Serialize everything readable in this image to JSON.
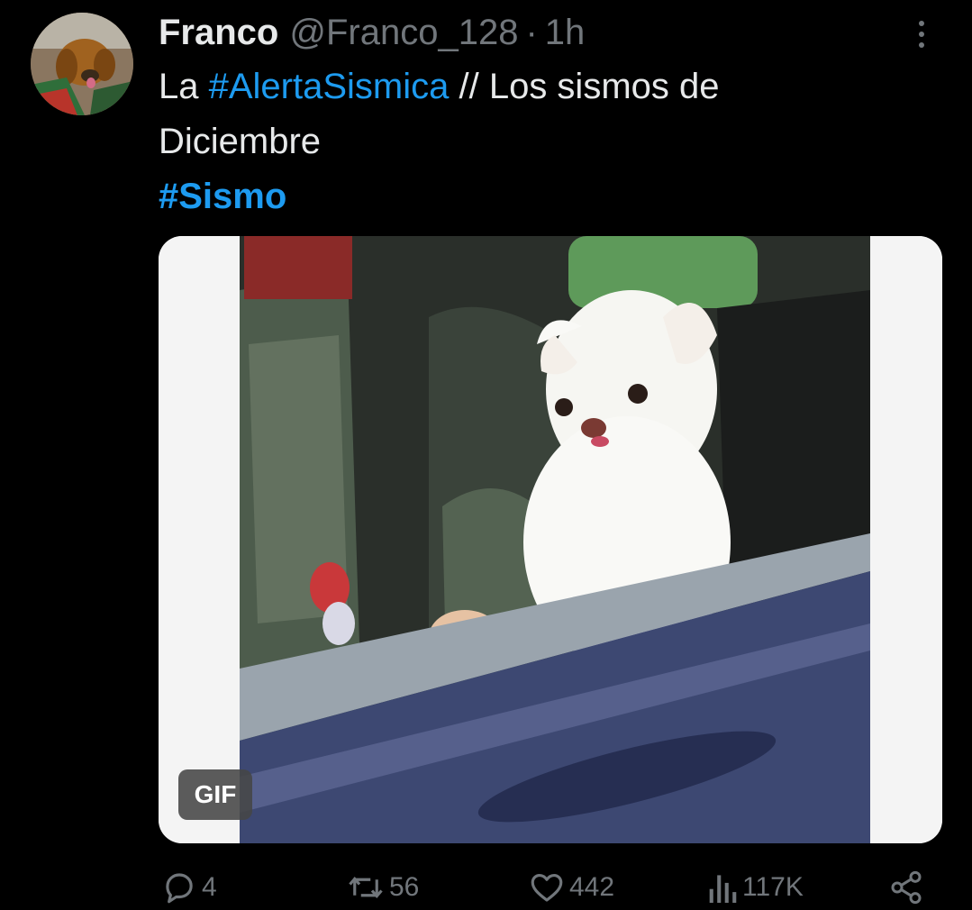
{
  "author": {
    "name": "Franco",
    "handle": "@Franco_128",
    "separator": "·",
    "time": "1h"
  },
  "tweet": {
    "text_start": "La ",
    "hashtag_1": "#AlertaSismica",
    "text_middle": " // Los sismos de",
    "text_line2": "Diciembre",
    "hashtag_2": "#Sismo"
  },
  "media": {
    "badge": "GIF"
  },
  "actions": {
    "replies": "4",
    "retweets": "56",
    "likes": "442",
    "views": "117K"
  },
  "icons": {
    "more": "more-vertical-icon",
    "reply": "reply-icon",
    "retweet": "retweet-icon",
    "like": "heart-icon",
    "views": "bar-chart-icon",
    "share": "share-icon"
  },
  "colors": {
    "background": "#000000",
    "text": "#e7e9ea",
    "secondary": "#71767b",
    "hashtag": "#1d9bf0"
  }
}
